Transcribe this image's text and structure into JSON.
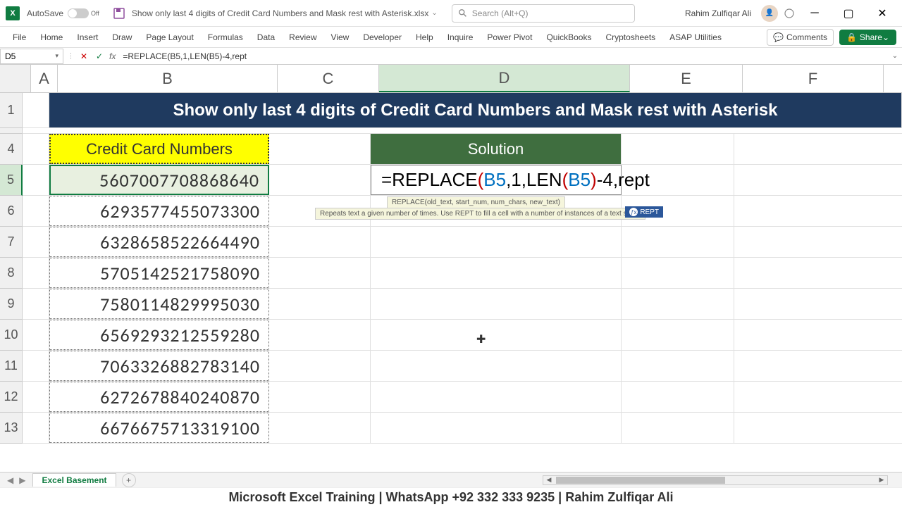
{
  "titlebar": {
    "autosave": "AutoSave",
    "autosave_state": "Off",
    "filename": "Show only last 4 digits of Credit Card Numbers and Mask rest with Asterisk.xlsx",
    "search_placeholder": "Search (Alt+Q)",
    "username": "Rahim Zulfiqar Ali"
  },
  "ribbon": {
    "tabs": [
      "File",
      "Home",
      "Insert",
      "Draw",
      "Page Layout",
      "Formulas",
      "Data",
      "Review",
      "View",
      "Developer",
      "Help",
      "Inquire",
      "Power Pivot",
      "QuickBooks",
      "Cryptosheets",
      "ASAP Utilities"
    ],
    "comments": "Comments",
    "share": "Share"
  },
  "formula_bar": {
    "cell_ref": "D5",
    "formula": "=REPLACE(B5,1,LEN(B5)-4,rept"
  },
  "columns": [
    "A",
    "B",
    "C",
    "D",
    "E",
    "F"
  ],
  "rows": [
    "1",
    "4",
    "5",
    "6",
    "7",
    "8",
    "9",
    "10",
    "11",
    "12",
    "13"
  ],
  "sheet": {
    "title": "Show only last 4 digits of Credit Card Numbers and Mask rest with Asterisk",
    "cc_header": "Credit Card Numbers",
    "solution_header": "Solution",
    "cc_numbers": [
      "5607007708868640",
      "6293577455073300",
      "6328658522664490",
      "5705142521758090",
      "7580114829995030",
      "6569293212559280",
      "7063326882783140",
      "6272678840240870",
      "6676675713319100"
    ],
    "formula_display": "=REPLACE(B5,1,LEN(B5)-4,rept",
    "tooltip_hint": "REPLACE(old_text, start_num, num_chars, new_text)",
    "tooltip_desc": "Repeats text a given number of times. Use REPT to fill a cell with a number of instances of a text string",
    "rept_badge": "REPT"
  },
  "sheet_tabs": {
    "active": "Excel Basement"
  },
  "footer": "Microsoft Excel Training | WhatsApp +92 332 333 9235 | Rahim Zulfiqar Ali"
}
